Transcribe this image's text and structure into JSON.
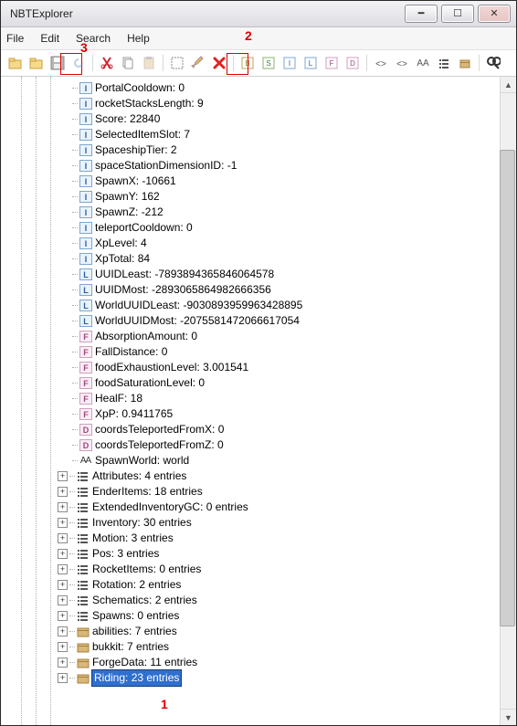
{
  "window": {
    "title": "NBTExplorer"
  },
  "menu": {
    "file": "File",
    "edit": "Edit",
    "search": "Search",
    "help": "Help"
  },
  "annotations": {
    "n1": "1",
    "n2": "2",
    "n3": "3"
  },
  "nodes": [
    {
      "indent": 3,
      "exp": "",
      "itype": "I",
      "label": "PortalCooldown: 0"
    },
    {
      "indent": 3,
      "exp": "",
      "itype": "I",
      "label": "rocketStacksLength: 9"
    },
    {
      "indent": 3,
      "exp": "",
      "itype": "I",
      "label": "Score: 22840"
    },
    {
      "indent": 3,
      "exp": "",
      "itype": "I",
      "label": "SelectedItemSlot: 7"
    },
    {
      "indent": 3,
      "exp": "",
      "itype": "I",
      "label": "SpaceshipTier: 2"
    },
    {
      "indent": 3,
      "exp": "",
      "itype": "I",
      "label": "spaceStationDimensionID: -1"
    },
    {
      "indent": 3,
      "exp": "",
      "itype": "I",
      "label": "SpawnX: -10661"
    },
    {
      "indent": 3,
      "exp": "",
      "itype": "I",
      "label": "SpawnY: 162"
    },
    {
      "indent": 3,
      "exp": "",
      "itype": "I",
      "label": "SpawnZ: -212"
    },
    {
      "indent": 3,
      "exp": "",
      "itype": "I",
      "label": "teleportCooldown: 0"
    },
    {
      "indent": 3,
      "exp": "",
      "itype": "I",
      "label": "XpLevel: 4"
    },
    {
      "indent": 3,
      "exp": "",
      "itype": "I",
      "label": "XpTotal: 84"
    },
    {
      "indent": 3,
      "exp": "",
      "itype": "L",
      "label": "UUIDLeast: -7893894365846064578"
    },
    {
      "indent": 3,
      "exp": "",
      "itype": "L",
      "label": "UUIDMost: -2893065864982666356"
    },
    {
      "indent": 3,
      "exp": "",
      "itype": "L",
      "label": "WorldUUIDLeast: -9030893959963428895"
    },
    {
      "indent": 3,
      "exp": "",
      "itype": "L",
      "label": "WorldUUIDMost: -2075581472066617054"
    },
    {
      "indent": 3,
      "exp": "",
      "itype": "F",
      "label": "AbsorptionAmount: 0"
    },
    {
      "indent": 3,
      "exp": "",
      "itype": "F",
      "label": "FallDistance: 0"
    },
    {
      "indent": 3,
      "exp": "",
      "itype": "F",
      "label": "foodExhaustionLevel: 3.001541"
    },
    {
      "indent": 3,
      "exp": "",
      "itype": "F",
      "label": "foodSaturationLevel: 0"
    },
    {
      "indent": 3,
      "exp": "",
      "itype": "F",
      "label": "HealF: 18"
    },
    {
      "indent": 3,
      "exp": "",
      "itype": "F",
      "label": "XpP: 0.9411765"
    },
    {
      "indent": 3,
      "exp": "",
      "itype": "D",
      "label": "coordsTeleportedFromX: 0"
    },
    {
      "indent": 3,
      "exp": "",
      "itype": "D",
      "label": "coordsTeleportedFromZ: 0"
    },
    {
      "indent": 3,
      "exp": "",
      "itype": "AA",
      "label": "SpawnWorld: world"
    },
    {
      "indent": 3,
      "exp": "+",
      "itype": "LIST",
      "label": "Attributes: 4 entries"
    },
    {
      "indent": 3,
      "exp": "+",
      "itype": "LIST",
      "label": "EnderItems: 18 entries"
    },
    {
      "indent": 3,
      "exp": "+",
      "itype": "LIST",
      "label": "ExtendedInventoryGC: 0 entries"
    },
    {
      "indent": 3,
      "exp": "+",
      "itype": "LIST",
      "label": "Inventory: 30 entries"
    },
    {
      "indent": 3,
      "exp": "+",
      "itype": "LIST",
      "label": "Motion: 3 entries"
    },
    {
      "indent": 3,
      "exp": "+",
      "itype": "LIST",
      "label": "Pos: 3 entries"
    },
    {
      "indent": 3,
      "exp": "+",
      "itype": "LIST",
      "label": "RocketItems: 0 entries"
    },
    {
      "indent": 3,
      "exp": "+",
      "itype": "LIST",
      "label": "Rotation: 2 entries"
    },
    {
      "indent": 3,
      "exp": "+",
      "itype": "LIST",
      "label": "Schematics: 2 entries"
    },
    {
      "indent": 3,
      "exp": "+",
      "itype": "LIST",
      "label": "Spawns: 0 entries"
    },
    {
      "indent": 3,
      "exp": "+",
      "itype": "BOX",
      "label": "abilities: 7 entries"
    },
    {
      "indent": 3,
      "exp": "+",
      "itype": "BOX",
      "label": "bukkit: 7 entries"
    },
    {
      "indent": 3,
      "exp": "+",
      "itype": "BOX",
      "label": "ForgeData: 11 entries"
    },
    {
      "indent": 3,
      "exp": "+",
      "itype": "BOX",
      "label": "Riding: 23 entries",
      "selected": true
    }
  ]
}
